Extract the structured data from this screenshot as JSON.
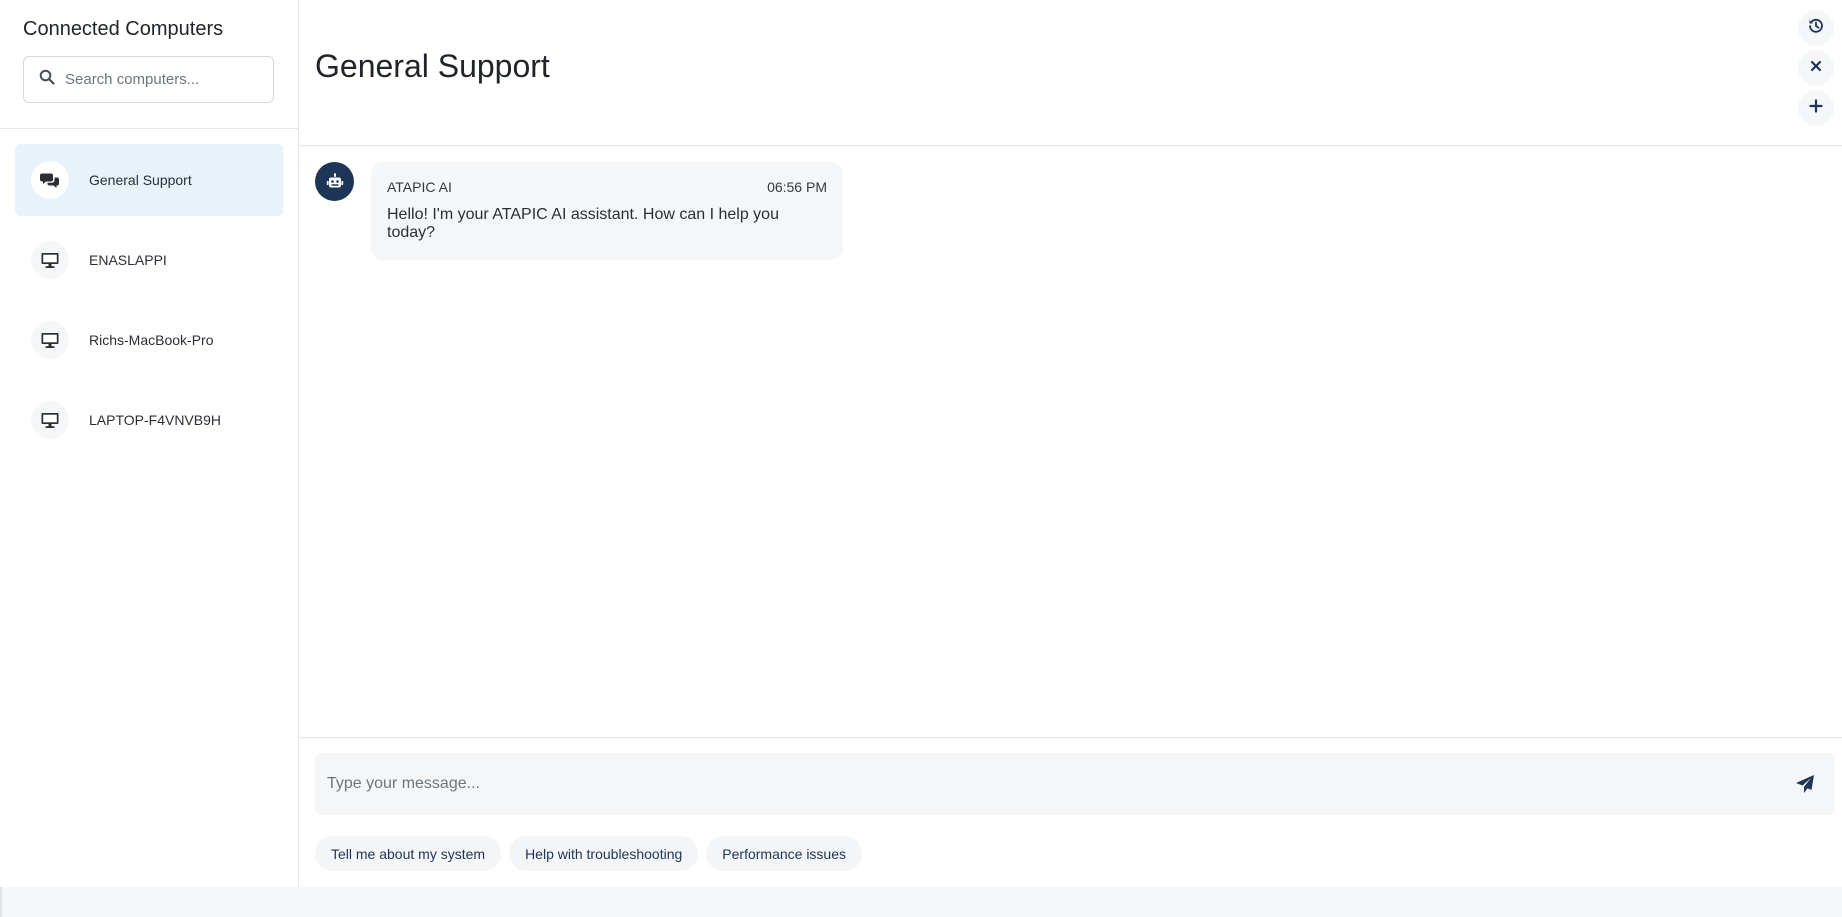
{
  "sidebar": {
    "title": "Connected Computers",
    "search": {
      "placeholder": "Search computers...",
      "value": "",
      "icon": "search-icon"
    },
    "items": [
      {
        "label": "General Support",
        "icon": "chat-bubbles-icon",
        "active": true
      },
      {
        "label": "ENASLAPPI",
        "icon": "desktop-icon",
        "active": false
      },
      {
        "label": "Richs-MacBook-Pro",
        "icon": "desktop-icon",
        "active": false
      },
      {
        "label": "LAPTOP-F4VNVB9H",
        "icon": "desktop-icon",
        "active": false
      }
    ]
  },
  "main": {
    "title": "General Support",
    "actions": [
      "history-icon",
      "close-icon",
      "plus-icon"
    ],
    "messages": [
      {
        "sender": "ATAPIC AI",
        "time": "06:56 PM",
        "text": "Hello! I'm your ATAPIC AI assistant. How can I help you today?",
        "avatar": "robot-icon"
      }
    ],
    "composer": {
      "placeholder": "Type your message...",
      "value": "",
      "send_icon": "paper-plane-icon"
    },
    "suggestions": [
      "Tell me about my system",
      "Help with troubleshooting",
      "Performance issues"
    ]
  },
  "colors": {
    "accent_dark": "#1d3557",
    "active_item_bg": "#e7f2fb",
    "bubble_bg": "#f5f6f8",
    "border": "#e3e6ea"
  }
}
